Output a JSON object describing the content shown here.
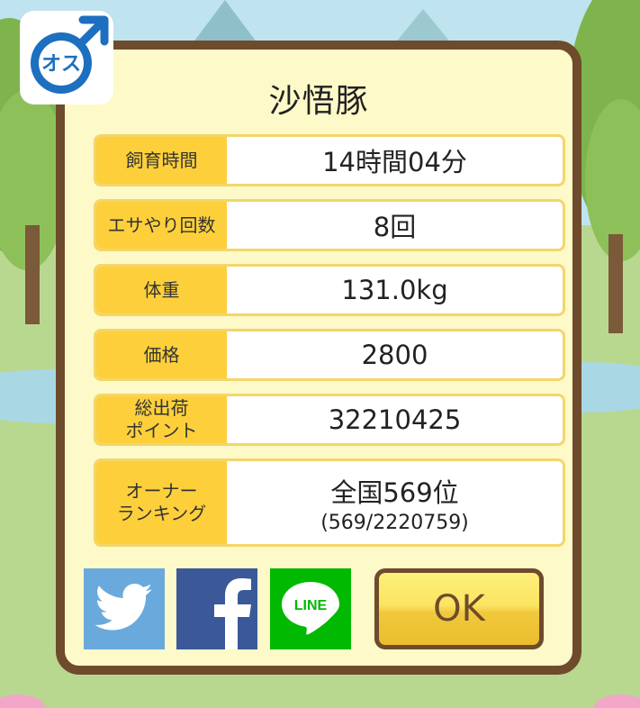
{
  "dialog": {
    "title": "沙悟豚",
    "gender_badge": "オス",
    "rows": [
      {
        "label": "飼育時間",
        "value": "14時間04分"
      },
      {
        "label": "エサやり回数",
        "value": "8回"
      },
      {
        "label": "体重",
        "value": "131.0kg"
      },
      {
        "label": "価格",
        "value": "2800"
      },
      {
        "label": "総出荷\nポイント",
        "value": "32210425"
      },
      {
        "label": "オーナー\nランキング",
        "value": "全国569位",
        "sub": "(569/2220759)"
      }
    ],
    "share": {
      "line_label": "LINE"
    },
    "ok_label": "OK"
  },
  "colors": {
    "frame": "#6e4b2c",
    "panel": "#fdf9c8",
    "label_bg": "#fdd03b",
    "twitter": "#6aa9dc",
    "facebook": "#3b5998",
    "line": "#00b900",
    "badge_blue": "#1d6fbf"
  },
  "icons": [
    "male-symbol-icon",
    "twitter-bird-icon",
    "facebook-f-icon",
    "line-bubble-icon"
  ]
}
